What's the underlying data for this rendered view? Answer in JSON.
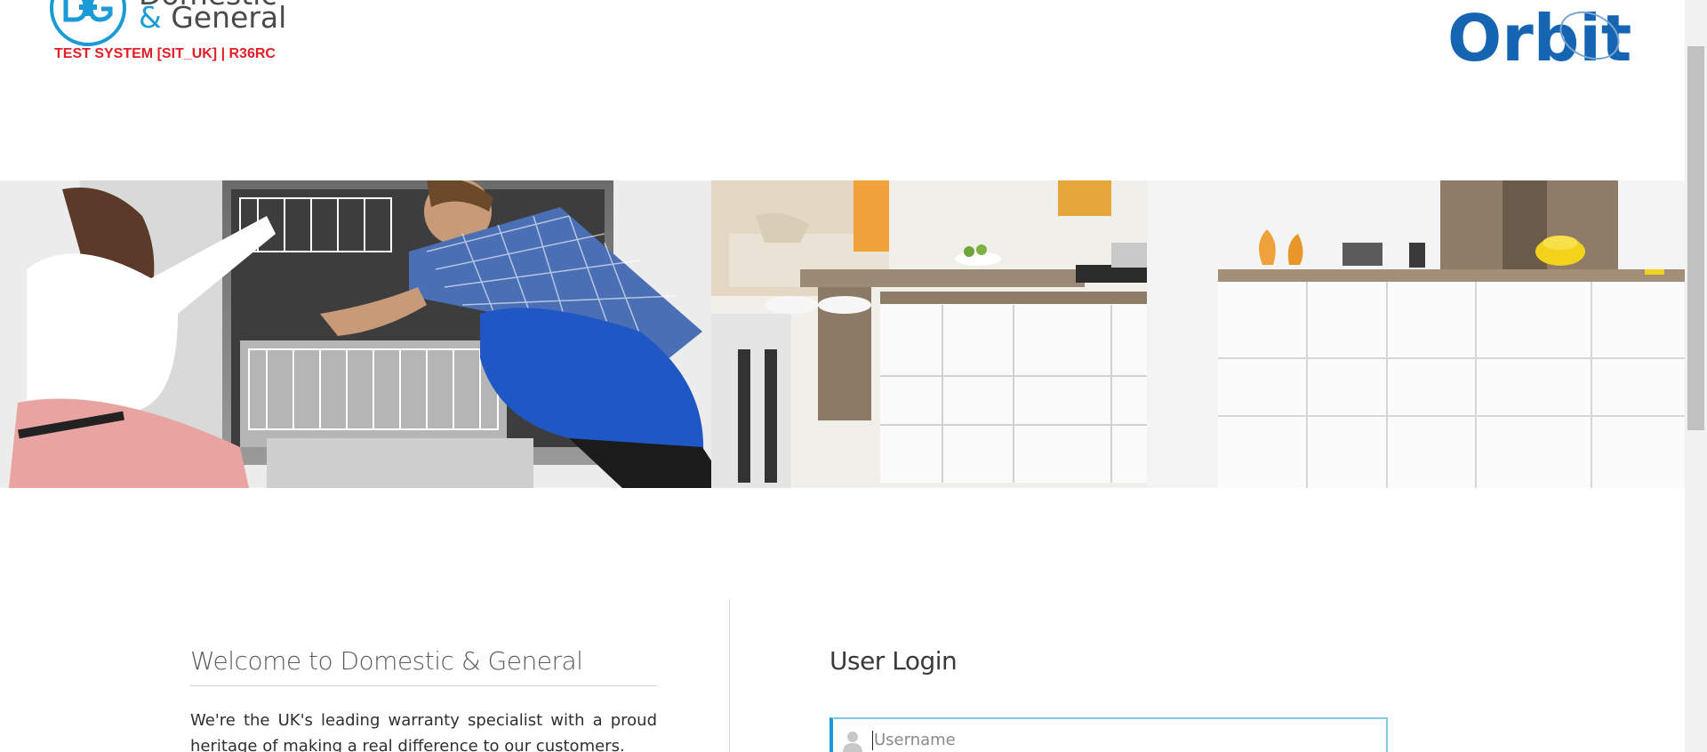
{
  "header": {
    "brand_line1": "Domestic",
    "brand_line2_amp": "&",
    "brand_line2_word": "General",
    "logo_monogram": "D+G",
    "environment_banner": "TEST SYSTEM [SIT_UK] | R36RC",
    "product_logo": "Orbit"
  },
  "hero": {
    "image_icon": "kitchen-engineer-photo"
  },
  "welcome": {
    "title": "Welcome to Domestic & General",
    "body": "We're the UK's leading warranty specialist with a proud heritage of making a real difference to our customers."
  },
  "login": {
    "title": "User Login",
    "username_placeholder": "Username",
    "username_value": "",
    "username_icon": "user-icon"
  },
  "colors": {
    "brand_blue": "#1a9ad6",
    "orbit_blue": "#1565b3",
    "banner_red": "#e31e24",
    "field_focus": "#7cc7ec"
  }
}
